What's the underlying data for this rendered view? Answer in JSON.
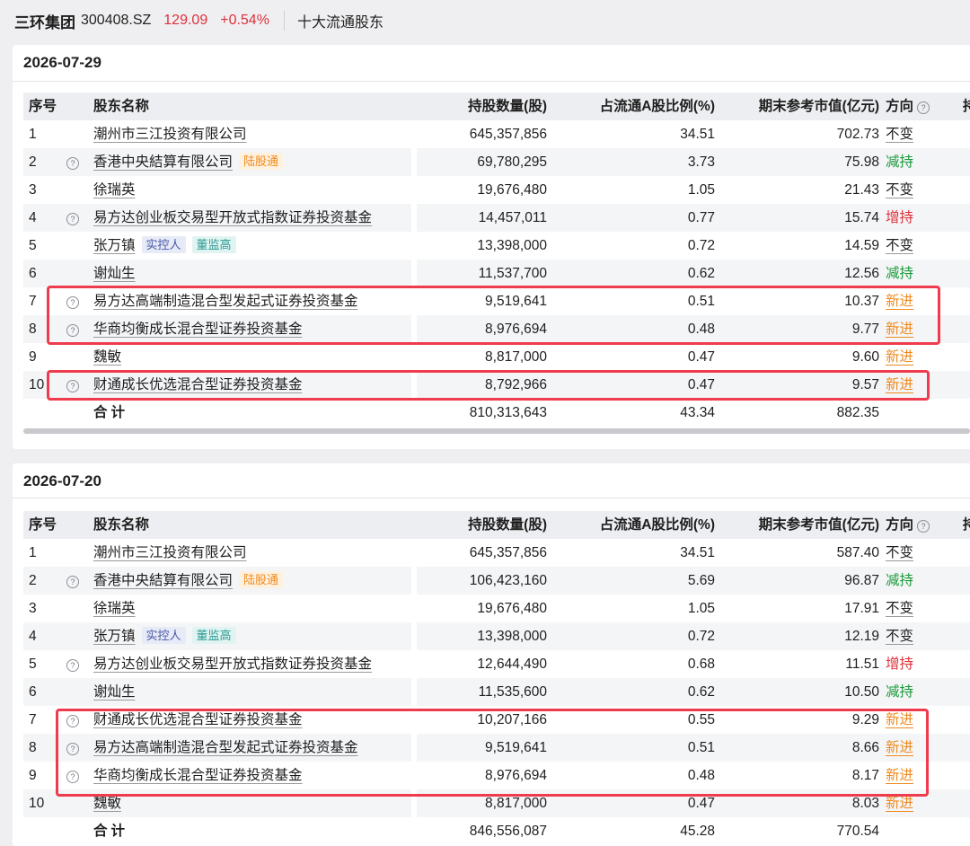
{
  "header": {
    "name": "三环集团",
    "code": "300408.SZ",
    "price": "129.09",
    "change": "+0.54%",
    "section": "十大流通股东"
  },
  "columns": {
    "idx": "序号",
    "name": "股东名称",
    "shares": "持股数量(股)",
    "ratio": "占流通A股比例(%)",
    "value": "期末参考市值(亿元)",
    "direction": "方向",
    "more": "持"
  },
  "icons": {
    "question": "question-icon"
  },
  "colors": {
    "rise": "#e0303a",
    "fall": "#1b9a3a",
    "new": "#ef8a1e",
    "highlight": "#ee3b4d"
  },
  "periods": [
    {
      "date": "2026-07-29",
      "rows": [
        {
          "idx": "1",
          "q": false,
          "name": "潮州市三江投资有限公司",
          "tags": [],
          "shares": "645,357,856",
          "ratio": "34.51",
          "value": "702.73",
          "dir": "不变",
          "dtype": "keep"
        },
        {
          "idx": "2",
          "q": true,
          "name": "香港中央結算有限公司",
          "tags": [
            {
              "t": "陆股通",
              "c": "lgt"
            }
          ],
          "shares": "69,780,295",
          "ratio": "3.73",
          "value": "75.98",
          "dir": "减持",
          "dtype": "down"
        },
        {
          "idx": "3",
          "q": false,
          "name": "徐瑞英",
          "tags": [],
          "shares": "19,676,480",
          "ratio": "1.05",
          "value": "21.43",
          "dir": "不变",
          "dtype": "keep"
        },
        {
          "idx": "4",
          "q": true,
          "name": "易方达创业板交易型开放式指数证券投资基金",
          "tags": [],
          "shares": "14,457,011",
          "ratio": "0.77",
          "value": "15.74",
          "dir": "增持",
          "dtype": "up"
        },
        {
          "idx": "5",
          "q": false,
          "name": "张万镇",
          "tags": [
            {
              "t": "实控人",
              "c": "ctrl"
            },
            {
              "t": "董监高",
              "c": "exec"
            }
          ],
          "shares": "13,398,000",
          "ratio": "0.72",
          "value": "14.59",
          "dir": "不变",
          "dtype": "keep"
        },
        {
          "idx": "6",
          "q": false,
          "name": "谢灿生",
          "tags": [],
          "shares": "11,537,700",
          "ratio": "0.62",
          "value": "12.56",
          "dir": "减持",
          "dtype": "down"
        },
        {
          "idx": "7",
          "q": true,
          "name": "易方达高端制造混合型发起式证券投资基金",
          "tags": [],
          "shares": "9,519,641",
          "ratio": "0.51",
          "value": "10.37",
          "dir": "新进",
          "dtype": "new"
        },
        {
          "idx": "8",
          "q": true,
          "name": "华商均衡成长混合型证券投资基金",
          "tags": [],
          "shares": "8,976,694",
          "ratio": "0.48",
          "value": "9.77",
          "dir": "新进",
          "dtype": "new"
        },
        {
          "idx": "9",
          "q": false,
          "name": "魏敏",
          "tags": [],
          "shares": "8,817,000",
          "ratio": "0.47",
          "value": "9.60",
          "dir": "新进",
          "dtype": "new"
        },
        {
          "idx": "10",
          "q": true,
          "name": "财通成长优选混合型证券投资基金",
          "tags": [],
          "shares": "8,792,966",
          "ratio": "0.47",
          "value": "9.57",
          "dir": "新进",
          "dtype": "new"
        }
      ],
      "total": {
        "label": "合计",
        "shares": "810,313,643",
        "ratio": "43.34",
        "value": "882.35"
      }
    },
    {
      "date": "2026-07-20",
      "rows": [
        {
          "idx": "1",
          "q": false,
          "name": "潮州市三江投资有限公司",
          "tags": [],
          "shares": "645,357,856",
          "ratio": "34.51",
          "value": "587.40",
          "dir": "不变",
          "dtype": "keep"
        },
        {
          "idx": "2",
          "q": true,
          "name": "香港中央結算有限公司",
          "tags": [
            {
              "t": "陆股通",
              "c": "lgt"
            }
          ],
          "shares": "106,423,160",
          "ratio": "5.69",
          "value": "96.87",
          "dir": "减持",
          "dtype": "down"
        },
        {
          "idx": "3",
          "q": false,
          "name": "徐瑞英",
          "tags": [],
          "shares": "19,676,480",
          "ratio": "1.05",
          "value": "17.91",
          "dir": "不变",
          "dtype": "keep"
        },
        {
          "idx": "4",
          "q": false,
          "name": "张万镇",
          "tags": [
            {
              "t": "实控人",
              "c": "ctrl"
            },
            {
              "t": "董监高",
              "c": "exec"
            }
          ],
          "shares": "13,398,000",
          "ratio": "0.72",
          "value": "12.19",
          "dir": "不变",
          "dtype": "keep"
        },
        {
          "idx": "5",
          "q": true,
          "name": "易方达创业板交易型开放式指数证券投资基金",
          "tags": [],
          "shares": "12,644,490",
          "ratio": "0.68",
          "value": "11.51",
          "dir": "增持",
          "dtype": "up"
        },
        {
          "idx": "6",
          "q": false,
          "name": "谢灿生",
          "tags": [],
          "shares": "11,535,600",
          "ratio": "0.62",
          "value": "10.50",
          "dir": "减持",
          "dtype": "down"
        },
        {
          "idx": "7",
          "q": true,
          "name": "财通成长优选混合型证券投资基金",
          "tags": [],
          "shares": "10,207,166",
          "ratio": "0.55",
          "value": "9.29",
          "dir": "新进",
          "dtype": "new"
        },
        {
          "idx": "8",
          "q": true,
          "name": "易方达高端制造混合型发起式证券投资基金",
          "tags": [],
          "shares": "9,519,641",
          "ratio": "0.51",
          "value": "8.66",
          "dir": "新进",
          "dtype": "new"
        },
        {
          "idx": "9",
          "q": true,
          "name": "华商均衡成长混合型证券投资基金",
          "tags": [],
          "shares": "8,976,694",
          "ratio": "0.48",
          "value": "8.17",
          "dir": "新进",
          "dtype": "new"
        },
        {
          "idx": "10",
          "q": false,
          "name": "魏敏",
          "tags": [],
          "shares": "8,817,000",
          "ratio": "0.47",
          "value": "8.03",
          "dir": "新进",
          "dtype": "new"
        }
      ],
      "total": {
        "label": "合计",
        "shares": "846,556,087",
        "ratio": "45.28",
        "value": "770.54"
      }
    }
  ]
}
